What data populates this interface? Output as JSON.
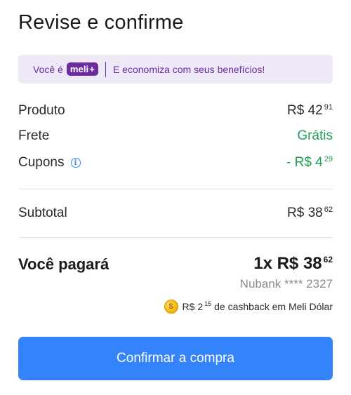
{
  "title": "Revise e confirme",
  "meli_banner": {
    "voce_label": "Você é",
    "badge": "meli",
    "badge_plus": "+",
    "benefit_text": "E economiza com seus benefícios!",
    "brand_color": "#6b2c9f",
    "background_color": "#efe8f7"
  },
  "summary": {
    "produto": {
      "label": "Produto",
      "value_main": "R$ 42",
      "value_cents": "91"
    },
    "frete": {
      "label": "Frete",
      "value": "Grátis"
    },
    "cupons": {
      "label": "Cupons",
      "info_icon": "info-icon",
      "value_main": "- R$ 4",
      "value_cents": "29"
    },
    "subtotal": {
      "label": "Subtotal",
      "value_main": "R$ 38",
      "value_cents": "62"
    }
  },
  "total": {
    "label": "Você pagará",
    "amount_main": "1x R$ 38",
    "amount_cents": "62",
    "payment_method": "Nubank **** 2327",
    "cashback_main": "R$ 2",
    "cashback_cents": "15",
    "cashback_text": "de cashback em Meli Dólar",
    "cashback_icon": "meli-dolar-coin-icon"
  },
  "confirm_button": {
    "label": "Confirmar a compra",
    "color": "#3483fa"
  },
  "colors": {
    "green": "#1e9e54",
    "accent": "#3483fa"
  }
}
